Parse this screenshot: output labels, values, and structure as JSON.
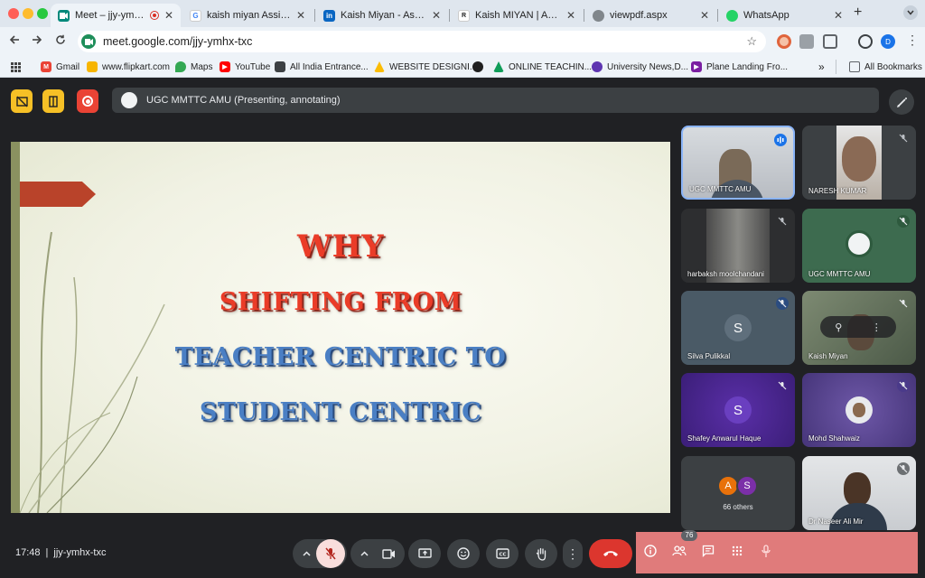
{
  "browser": {
    "tabs": [
      {
        "title": "Meet – jjy-ymhx-txc",
        "icon": "google-meet-icon",
        "active": true
      },
      {
        "title": "kaish miyan Assistant P",
        "icon": "google-icon"
      },
      {
        "title": "Kaish Miyan - Assistant",
        "icon": "linkedin-icon"
      },
      {
        "title": "Kaish MIYAN | Assistant",
        "icon": "researchgate-icon"
      },
      {
        "title": "viewpdf.aspx",
        "icon": "globe-icon"
      },
      {
        "title": "WhatsApp",
        "icon": "whatsapp-icon"
      }
    ],
    "new_tab_label": "+",
    "url": "meet.google.com/jjy-ymhx-txc",
    "profile_initial": "D",
    "bookmarks": [
      {
        "label": "Gmail",
        "icon": "gmail-icon"
      },
      {
        "label": "www.flipkart.com",
        "icon": "flipkart-icon"
      },
      {
        "label": "Maps",
        "icon": "maps-icon"
      },
      {
        "label": "YouTube",
        "icon": "youtube-icon"
      },
      {
        "label": "All India Entrance...",
        "icon": "site-icon"
      },
      {
        "label": "WEBSITE DESIGNI...",
        "icon": "drive-icon"
      },
      {
        "label": "",
        "icon": "github-icon"
      },
      {
        "label": "ONLINE TEACHIN...",
        "icon": "drive-icon"
      },
      {
        "label": "University News,D...",
        "icon": "globe-icon"
      },
      {
        "label": "Plane Landing Fro...",
        "icon": "play-icon"
      }
    ],
    "more_bookmarks": "»",
    "all_bookmarks": "All Bookmarks"
  },
  "meet": {
    "presenting_text": "UGC MMTTC AMU (Presenting, annotating)",
    "slide": {
      "line1": "WHY",
      "line2": "SHIFTING FROM",
      "line3": "TEACHER CENTRIC TO",
      "line4": "STUDENT CENTRIC"
    },
    "participants": [
      {
        "name": "UGC MMTTC AMU",
        "kind": "video",
        "speaking": true
      },
      {
        "name": "NARESH KUMAR",
        "kind": "video",
        "muted": true
      },
      {
        "name": "harbaksh moolchandani",
        "kind": "video",
        "muted": true
      },
      {
        "name": "UGC MMTTC AMU",
        "kind": "logo",
        "muted": true
      },
      {
        "name": "Silva Pulikkal",
        "kind": "avatar",
        "initial": "S",
        "muted": true
      },
      {
        "name": "Kaish Miyan",
        "kind": "video",
        "muted": true
      },
      {
        "name": "Shafey Anwarul Haque",
        "kind": "avatar",
        "initial": "S",
        "muted": true
      },
      {
        "name": "Mohd Shahwaiz",
        "kind": "photo",
        "muted": true
      },
      {
        "name": "66 others",
        "kind": "others",
        "initials": [
          "A",
          "S"
        ]
      },
      {
        "name": "Dr Naseer Ali Mir",
        "kind": "video",
        "muted": true
      }
    ],
    "time": "17:48",
    "meeting_code": "jjy-ymhx-txc",
    "people_count": "76"
  }
}
